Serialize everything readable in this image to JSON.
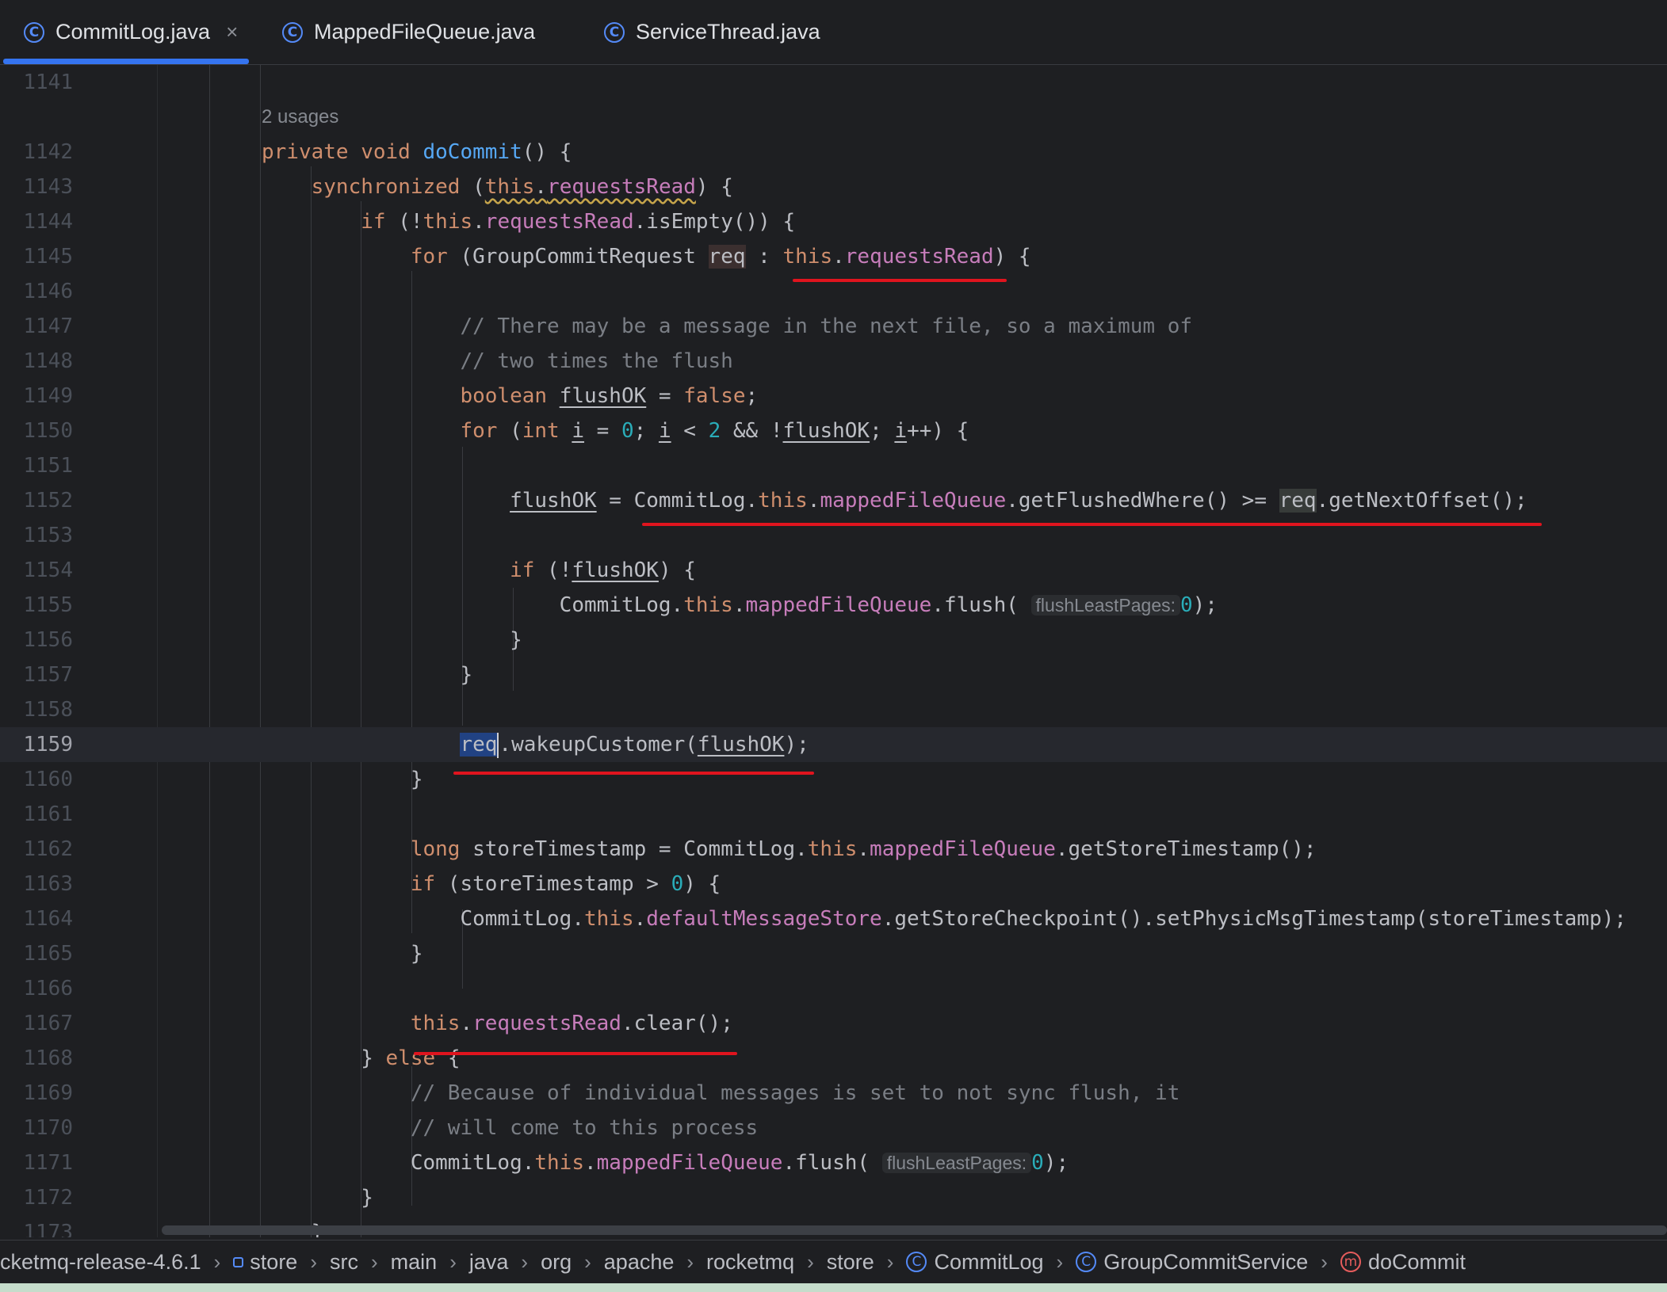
{
  "tabs": [
    {
      "label": "CommitLog.java",
      "icon": "class-icon",
      "active": true
    },
    {
      "label": "MappedFileQueue.java",
      "icon": "class-icon"
    },
    {
      "label": "ServiceThread.java",
      "icon": "class-icon"
    }
  ],
  "editor": {
    "usages_hint": "2 usages",
    "param_hint": "flushLeastPages:",
    "line_numbers": [
      "1141",
      "1142",
      "1143",
      "1144",
      "1145",
      "1146",
      "1147",
      "1148",
      "1149",
      "1150",
      "1151",
      "1152",
      "1153",
      "1154",
      "1155",
      "1156",
      "1157",
      "1158",
      "1159",
      "1160",
      "1161",
      "1162",
      "1163",
      "1164",
      "1165",
      "1166",
      "1167",
      "1168",
      "1169",
      "1170",
      "1171",
      "1172",
      "1173"
    ],
    "caret_line": "1159",
    "annotation_color": "#e0141e"
  },
  "breadcrumb": [
    {
      "label": "cketmq-release-4.6.1"
    },
    {
      "label": "store",
      "icon": "module-icon"
    },
    {
      "label": "src"
    },
    {
      "label": "main"
    },
    {
      "label": "java"
    },
    {
      "label": "org"
    },
    {
      "label": "apache"
    },
    {
      "label": "rocketmq"
    },
    {
      "label": "store"
    },
    {
      "label": "CommitLog",
      "icon": "class-icon"
    },
    {
      "label": "GroupCommitService",
      "icon": "class-icon"
    },
    {
      "label": "doCommit",
      "icon": "method-icon"
    }
  ]
}
